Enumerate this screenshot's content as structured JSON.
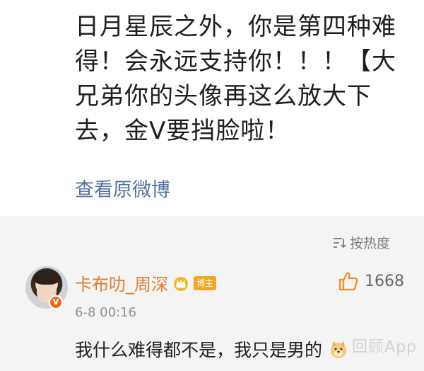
{
  "post": {
    "lines": [
      "日月星辰之外，你是第四种难",
      "得！会永远支持你！！！【大",
      "兄弟你的头像再这么放大下",
      "去，金V要挡脸啦！"
    ],
    "view_original": "查看原微博"
  },
  "comments": {
    "sort_label": "按热度",
    "sort_icon": "sort-icon",
    "items": [
      {
        "username": "卡布叻_周深",
        "badge_icon": "crown-icon",
        "host_tag": "博主",
        "verified_mark": "V",
        "timestamp": "6-8 00:16",
        "text": "我什么难得都不是，我只是男的",
        "like_icon": "thumbs-up-icon",
        "likes": "1668"
      }
    ]
  },
  "watermark": "· 回顾App",
  "colors": {
    "username": "#e07d2e",
    "link": "#55739d",
    "comment_bg": "#f4f4f4",
    "like_icon": "#f08a24"
  }
}
